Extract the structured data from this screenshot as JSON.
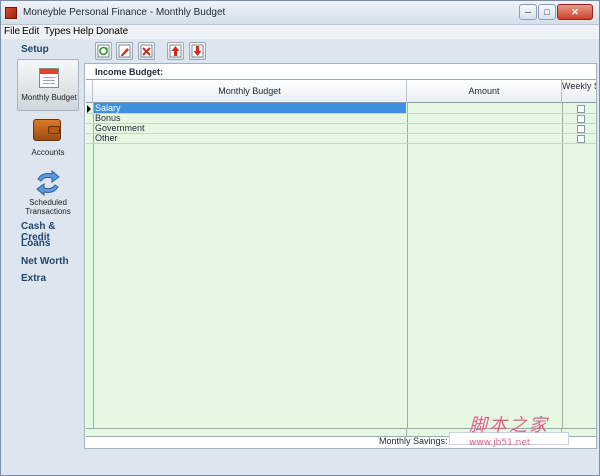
{
  "window": {
    "title": "Moneyble Personal Finance - Monthly Budget",
    "minimize_glyph": "─",
    "maximize_glyph": "□",
    "close_glyph": "✕"
  },
  "menu": [
    "File",
    "Edit",
    "Types",
    "Help",
    "Donate"
  ],
  "sidebar": {
    "setup_header": "Setup",
    "tiles": [
      {
        "label": "Monthly Budget",
        "icon": "calendar-icon"
      },
      {
        "label": "Accounts",
        "icon": "wallet-icon"
      },
      {
        "label": "Scheduled Transactions",
        "icon": "sync-icon"
      }
    ],
    "sections": [
      "Cash & Credit",
      "Loans",
      "Net Worth",
      "Extra"
    ]
  },
  "toolbar": {
    "buttons": [
      "refresh-icon",
      "edit-icon",
      "delete-icon",
      "move-up-icon",
      "move-down-icon"
    ]
  },
  "main": {
    "section_title": "Income Budget:",
    "columns": [
      "Monthly Budget",
      "Amount",
      "Weekly Subtotal"
    ],
    "rows": [
      {
        "name": "Salary",
        "selected": true
      },
      {
        "name": "Bonus",
        "selected": false
      },
      {
        "name": "Government",
        "selected": false
      },
      {
        "name": "Other",
        "selected": false
      }
    ],
    "savings_label": "Monthly Savings:",
    "savings_value": ""
  },
  "watermark": {
    "text_cn": "脚本之家",
    "url": "www.jb51.net"
  },
  "colors": {
    "grid_bg": "#e4f8e2",
    "selection": "#3d8fe0",
    "nav_header": "#22466c",
    "watermark": "#e0608a"
  }
}
